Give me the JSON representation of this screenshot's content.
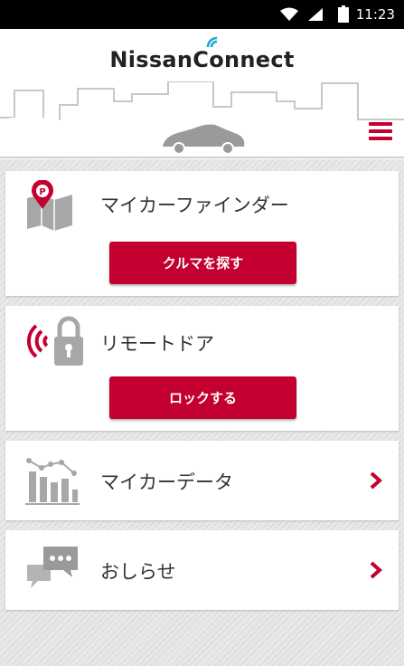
{
  "status_bar": {
    "time": "11:23"
  },
  "header": {
    "logo_text": "NissanConnect",
    "brand_color": "#c3002f"
  },
  "cards": [
    {
      "title": "マイカーファインダー",
      "button_label": "クルマを探す",
      "icon": "parking-map-icon"
    },
    {
      "title": "リモートドア",
      "button_label": "ロックする",
      "icon": "remote-lock-icon"
    },
    {
      "title": "マイカーデータ",
      "icon": "bar-chart-icon"
    },
    {
      "title": "おしらせ",
      "icon": "chat-bubbles-icon"
    }
  ]
}
